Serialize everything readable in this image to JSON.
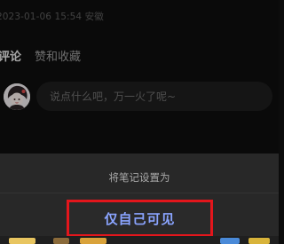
{
  "note_meta": {
    "text": "2023-01-06 15:54 安徽"
  },
  "tabs": {
    "comments": "评论",
    "likes_collects": "赞和收藏"
  },
  "comment_box": {
    "placeholder": "说点什么吧，万一火了呢~"
  },
  "visibility_sheet": {
    "title": "将笔记设置为",
    "option_private": "仅自己可见",
    "highlight_color": "#e3161c",
    "option_color": "#8aa4ff"
  }
}
